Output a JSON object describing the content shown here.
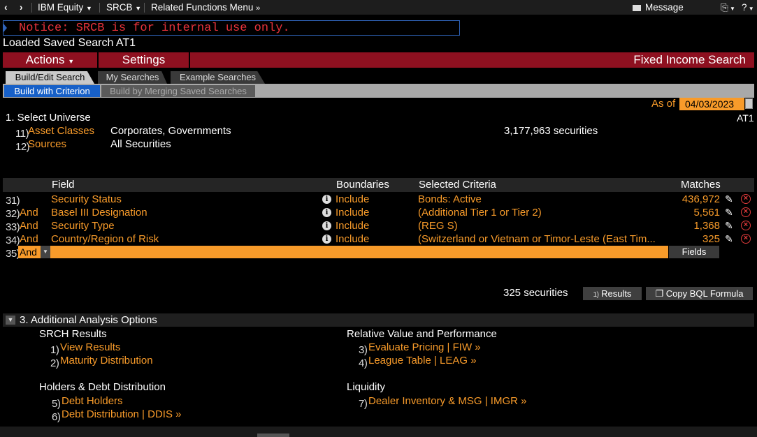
{
  "topbar": {
    "back_icon": "chevron-left-icon",
    "forward_icon": "chevron-right-icon",
    "security": "IBM Equity",
    "function": "SRCB",
    "related": "Related Functions Menu",
    "message": "Message",
    "help": "?"
  },
  "notice": "Notice: SRCB is for internal use only.",
  "loaded": "Loaded Saved Search AT1",
  "menubar": {
    "actions": "Actions",
    "settings": "Settings",
    "title": "Fixed Income Search",
    "color": "#8e1020"
  },
  "tabs": [
    "Build/Edit Search",
    "My Searches",
    "Example Searches"
  ],
  "subtabs": [
    "Build with Criterion",
    "Build by Merging Saved Searches"
  ],
  "asof": {
    "label": "As of",
    "value": "04/03/2023",
    "name": "AT1"
  },
  "universe": {
    "heading": "1. Select Universe",
    "items": [
      {
        "num": "11)",
        "label": "Asset Classes",
        "value": "Corporates, Governments"
      },
      {
        "num": "12)",
        "label": "Sources",
        "value": "All Securities"
      }
    ],
    "count": "3,177,963 securities"
  },
  "table": {
    "headers": {
      "field": "Field",
      "boundaries": "Boundaries",
      "criteria": "Selected Criteria",
      "matches": "Matches"
    },
    "rows": [
      {
        "num": "31)",
        "op": "",
        "field": "Security Status",
        "boundary": "Include",
        "criteria": "Bonds: Active",
        "matches": "436,972"
      },
      {
        "num": "32)",
        "op": "And",
        "field": "Basel III Designation",
        "boundary": "Include",
        "criteria": "(Additional Tier 1 or Tier 2)",
        "matches": "5,561"
      },
      {
        "num": "33)",
        "op": "And",
        "field": "Security Type",
        "boundary": "Include",
        "criteria": "(REG S)",
        "matches": "1,368"
      },
      {
        "num": "34)",
        "op": "And",
        "field": "Country/Region of Risk",
        "boundary": "Include",
        "criteria": "(Switzerland or Vietnam or Timor-Leste (East Tim...",
        "matches": "325"
      }
    ],
    "new_row": {
      "num": "35)",
      "op": "And",
      "fields_button": "Fields"
    }
  },
  "results": {
    "count": "325 securities",
    "results_num": "1)",
    "results_label": "Results",
    "bql_label": "Copy BQL Formula"
  },
  "analysis": {
    "title": "3. Additional Analysis Options",
    "groups": [
      {
        "heading": "SRCH Results",
        "items": [
          {
            "num": "1)",
            "label": "View Results"
          },
          {
            "num": "2)",
            "label": "Maturity Distribution"
          }
        ]
      },
      {
        "heading": "Relative Value and Performance",
        "items": [
          {
            "num": "3)",
            "label": "Evaluate Pricing | FIW »"
          },
          {
            "num": "4)",
            "label": "League Table | LEAG »"
          }
        ]
      },
      {
        "heading": "Holders & Debt Distribution",
        "items": [
          {
            "num": "5)",
            "label": "Debt Holders"
          },
          {
            "num": "6)",
            "label": "Debt Distribution | DDIS »"
          }
        ]
      },
      {
        "heading": "Liquidity",
        "items": [
          {
            "num": "7)",
            "label": "Dealer Inventory & MSG | IMGR »"
          }
        ]
      }
    ]
  }
}
